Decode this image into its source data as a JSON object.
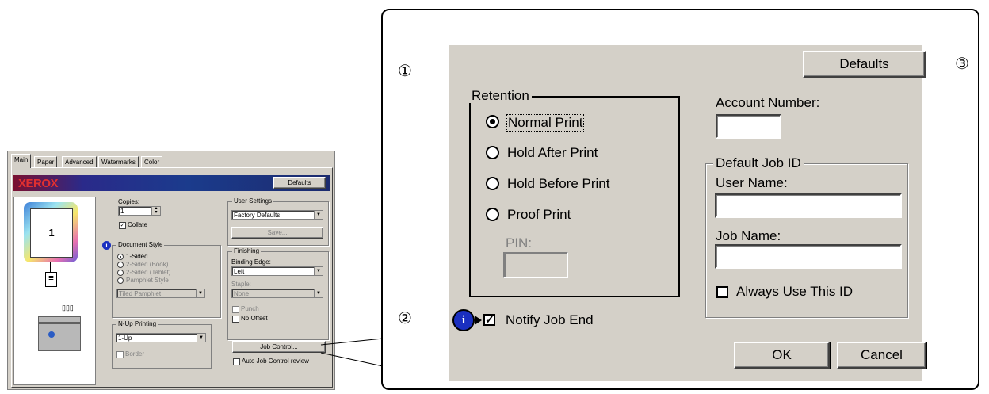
{
  "mini": {
    "tabs": [
      "Main",
      "Paper",
      "Advanced",
      "Watermarks",
      "Color"
    ],
    "logo": "XEROX",
    "defaults_button": "Defaults",
    "preview_page_number": "1",
    "copies_label": "Copies:",
    "copies_value": "1",
    "collate_label": "Collate",
    "document_style": {
      "title": "Document Style",
      "options": [
        "1-Sided",
        "2-Sided (Book)",
        "2-Sided (Tablet)",
        "Pamphlet Style"
      ],
      "pamphlet_value": "Tiled Pamphlet"
    },
    "nup": {
      "title": "N-Up Printing",
      "value": "1-Up",
      "border_label": "Border"
    },
    "user_settings": {
      "title": "User Settings",
      "value": "Factory Defaults",
      "save_button": "Save..."
    },
    "finishing": {
      "title": "Finishing",
      "binding_edge_label": "Binding Edge:",
      "binding_edge_value": "Left",
      "staple_label": "Staple:",
      "staple_value": "None",
      "punch_label": "Punch",
      "no_offset_label": "No Offset"
    },
    "job_control_button": "Job Control...",
    "auto_review_label": "Auto Job Control review"
  },
  "dialog": {
    "defaults_button": "Defaults",
    "retention": {
      "title": "Retention",
      "options": [
        "Normal Print",
        "Hold After Print",
        "Hold Before Print",
        "Proof Print"
      ],
      "selected": "Normal Print",
      "pin_label": "PIN:"
    },
    "account_number_label": "Account Number:",
    "default_job_id": {
      "title": "Default Job ID",
      "user_name_label": "User Name:",
      "job_name_label": "Job Name:",
      "always_use_label": "Always Use This ID"
    },
    "notify_label": "Notify Job End",
    "ok_button": "OK",
    "cancel_button": "Cancel"
  },
  "callouts": [
    "①",
    "②",
    "③"
  ]
}
